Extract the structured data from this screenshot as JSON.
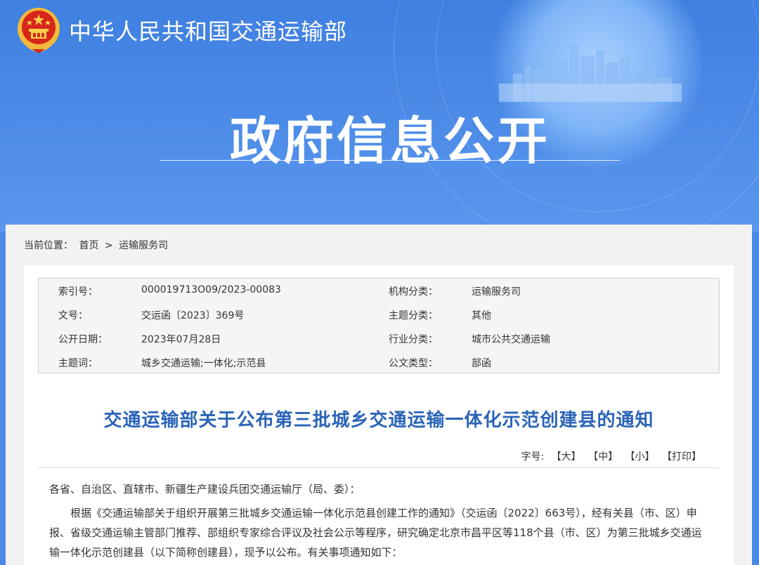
{
  "header": {
    "site_name": "中华人民共和国交通运输部",
    "banner_title": "政府信息公开"
  },
  "breadcrumb": {
    "prefix": "当前位置：",
    "home": "首页",
    "separator": ">",
    "current": "运输服务司"
  },
  "meta": {
    "rows": [
      [
        {
          "label": "索引号：",
          "value": "000019713O09/2023-00083"
        },
        {
          "label": "机构分类：",
          "value": "运输服务司"
        }
      ],
      [
        {
          "label": "文号：",
          "value": "交运函〔2023〕369号"
        },
        {
          "label": "主题分类：",
          "value": "其他"
        }
      ],
      [
        {
          "label": "公开日期：",
          "value": "2023年07月28日"
        },
        {
          "label": "行业分类：",
          "value": "城市公共交通运输"
        }
      ],
      [
        {
          "label": "主题词：",
          "value": "城乡交通运输;一体化;示范县"
        },
        {
          "label": "公文类型：",
          "value": "部函"
        }
      ]
    ]
  },
  "article": {
    "title": "交通运输部关于公布第三批城乡交通运输一体化示范创建县的通知",
    "font_size_label": "字号:",
    "size_large": "【大】",
    "size_medium": "【中】",
    "size_small": "【小】",
    "print": "【打印】",
    "addressee": "各省、自治区、直辖市、新疆生产建设兵团交通运输厅（局、委）：",
    "paragraph1": "根据《交通运输部关于组织开展第三批城乡交通运输一体化示范县创建工作的通知》（交运函〔2022〕663号），经有关县（市、区）申报、省级交通运输主管部门推荐、部组织专家综合评议及社会公示等程序，研究确定北京市昌平区等118个县（市、区）为第三批城乡交通运输一体化示范创建县（以下简称创建县），现予以公布。有关事项通知如下："
  },
  "colors": {
    "banner": "#4a8ae6",
    "title_blue": "#2b64b8",
    "page_bg": "#f2f2f2"
  }
}
